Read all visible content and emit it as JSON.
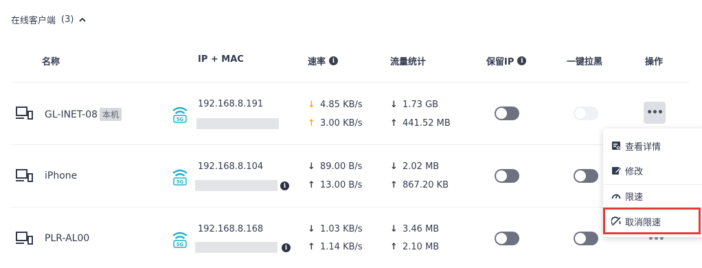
{
  "section": {
    "title": "在线客户端",
    "count": "(3)",
    "collapse_icon": "chevron-up-icon"
  },
  "columns": {
    "name": "名称",
    "ip_mac": "IP + MAC",
    "rate": "速率",
    "traffic": "流量统计",
    "reserve_ip": "保留IP",
    "block": "一键拉黑",
    "actions": "操作"
  },
  "rows": [
    {
      "name": "GL-INET-08",
      "badge": "本机",
      "ip": "192.168.8.191",
      "rate_down": "4.85 KB/s",
      "rate_up": "3.00 KB/s",
      "traffic_down": "1.73 GB",
      "traffic_up": "441.52 MB",
      "reserve_ip": false,
      "block_disabled": true,
      "rate_arrow_color": "#f5a623"
    },
    {
      "name": "iPhone",
      "ip": "192.168.8.104",
      "rate_down": "89.00 B/s",
      "rate_up": "13.00 B/s",
      "traffic_down": "2.02 MB",
      "traffic_up": "867.20 KB",
      "reserve_ip": false,
      "block_disabled": false
    },
    {
      "name": "PLR-AL00",
      "ip": "192.168.8.168",
      "rate_down": "1.03 KB/s",
      "rate_up": "1.14 KB/s",
      "traffic_down": "3.46 MB",
      "traffic_up": "2.10 MB",
      "reserve_ip": false,
      "block_disabled": false
    }
  ],
  "wifi_badge": "5G",
  "info_glyph": "i",
  "more_glyph": "•••",
  "arrows": {
    "down": "↓",
    "up": "↑"
  },
  "menu": {
    "items": [
      {
        "label": "查看详情",
        "icon": "details-icon"
      },
      {
        "label": "修改",
        "icon": "edit-icon"
      },
      {
        "label": "限速",
        "icon": "speed-limit-icon"
      },
      {
        "label": "取消限速",
        "icon": "cancel-speed-limit-icon"
      }
    ]
  },
  "colors": {
    "accent_wifi": "#1fb0c4",
    "highlight": "#e53935",
    "orange_arrow": "#f5a623"
  }
}
